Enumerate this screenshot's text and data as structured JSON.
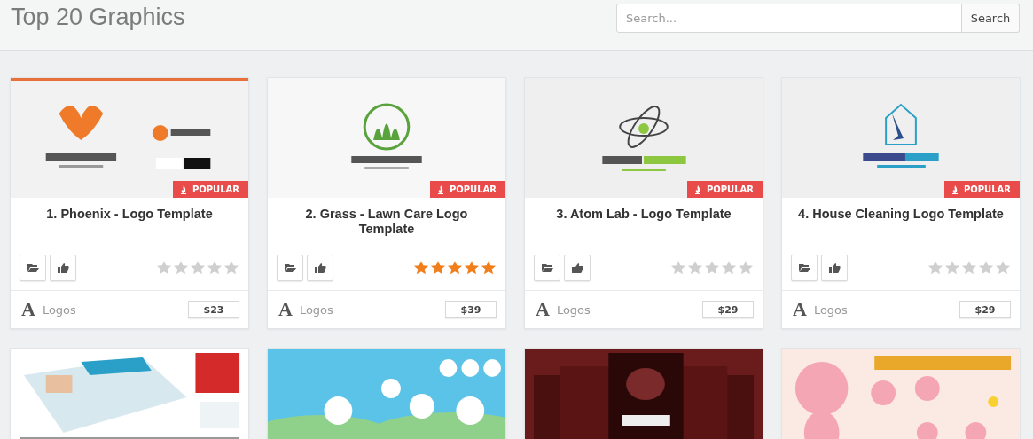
{
  "header": {
    "title": "Top 20 Graphics",
    "search": {
      "placeholder": "Search...",
      "button": "Search"
    }
  },
  "products": [
    {
      "title": "1. Phoenix - Logo Template",
      "badge": "POPULAR",
      "stars": 0,
      "category_icon": "A",
      "category": "Logos",
      "price": "$23"
    },
    {
      "title": "2. Grass - Lawn Care Logo Template",
      "badge": "POPULAR",
      "stars": 5,
      "category_icon": "A",
      "category": "Logos",
      "price": "$39"
    },
    {
      "title": "3. Atom Lab - Logo Template",
      "badge": "POPULAR",
      "stars": 0,
      "category_icon": "A",
      "category": "Logos",
      "price": "$29"
    },
    {
      "title": "4. House Cleaning Logo Template",
      "badge": "POPULAR",
      "stars": 0,
      "category_icon": "A",
      "category": "Logos",
      "price": "$29"
    }
  ]
}
